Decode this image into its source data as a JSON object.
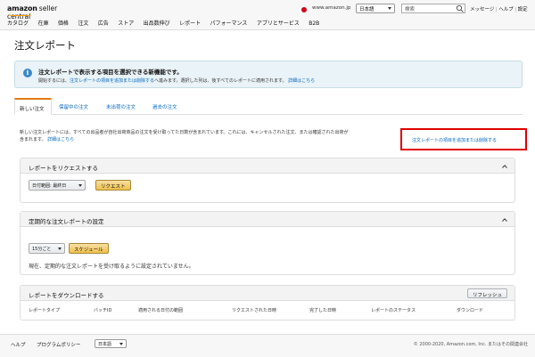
{
  "header": {
    "brand": "amazon",
    "brand_suffix": "seller central",
    "domain": "www.amazon.jp",
    "language": "日本語",
    "search_placeholder": "検索",
    "links": [
      "メッセージ",
      "ヘルプ",
      "設定"
    ]
  },
  "nav": [
    "カタログ",
    "在庫",
    "価格",
    "注文",
    "広告",
    "ストア",
    "出品数伸び",
    "レポート",
    "パフォーマンス",
    "アプリとサービス",
    "B2B"
  ],
  "page_title": "注文レポート",
  "info": {
    "title": "注文レポートで表示する項目を選択できる新機能です。",
    "text_before": "開始するには、",
    "text_link": "注文レポートの項目を追加または削除する",
    "text_after": "へ進みます。選択した列は、後すべてのレポートに適用されます。",
    "details_link": "詳細はこちら"
  },
  "tabs": [
    "新しい注文",
    "保留中の注文",
    "未出荷の注文",
    "過去の注文"
  ],
  "description": {
    "text": "新しい注文レポートには、すべての出品者が自社出荷商品の注文を受け取ってた日数が含まれています。これには、キャンセルされた注文、または確認された出荷が含まれます。",
    "link": "詳細はこちら"
  },
  "add_remove_link": "注文レポートの項目を追加または削除する",
  "request_panel": {
    "title": "レポートをリクエストする",
    "date_range": "日付範囲: 最終日",
    "button": "リクエスト"
  },
  "schedule_panel": {
    "title": "定期的な注文レポートの設定",
    "interval": "15分ごと",
    "button": "スケジュール",
    "status": "現在、定期的な注文レポートを受け取るように設定されていません。"
  },
  "download_panel": {
    "title": "レポートをダウンロードする",
    "refresh_button": "リフレッシュ",
    "columns": [
      "レポートタイプ",
      "バッチID",
      "適用される日付の範囲",
      "リクエストされた日時",
      "完了した日時",
      "レポートのステータス",
      "ダウンロード"
    ]
  },
  "footer": {
    "help": "ヘルプ",
    "policy": "プログラムポリシー",
    "language": "日本語",
    "copyright": "© 2000-2020, Amazon.com, Inc. またはその関連会社"
  },
  "colors": {
    "accent_orange": "#e47911",
    "link_blue": "#0066c0",
    "highlight_red": "#e00000",
    "button_yellow": "#f0c14b"
  }
}
